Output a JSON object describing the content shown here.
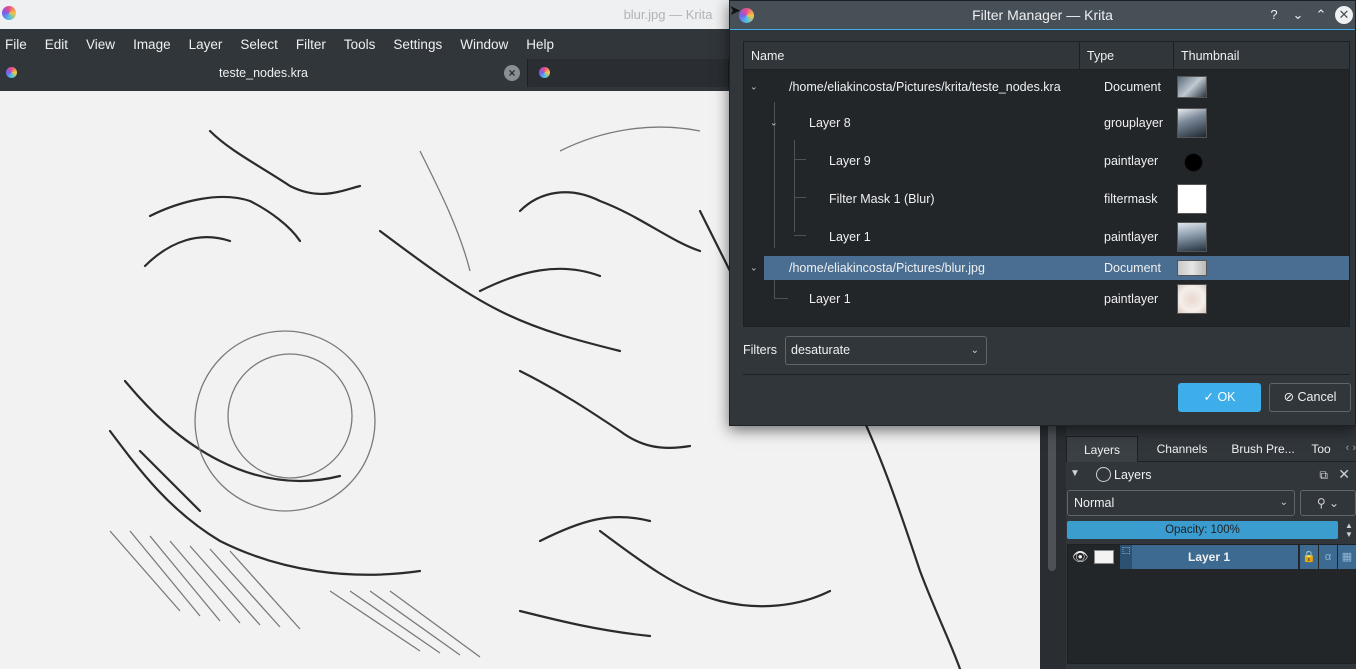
{
  "main_window": {
    "title": "blur.jpg — Krita",
    "menu": [
      "File",
      "Edit",
      "View",
      "Image",
      "Layer",
      "Select",
      "Filter",
      "Tools",
      "Settings",
      "Window",
      "Help"
    ],
    "tabs": [
      {
        "label": "teste_nodes.kra",
        "close_symbol": "×"
      },
      {
        "label": ""
      }
    ]
  },
  "dialog": {
    "title": "Filter Manager — Krita",
    "titlebar_buttons": {
      "help": "?",
      "minimize": "⌄",
      "maximize": "⌃",
      "close": "✕"
    },
    "columns": {
      "name": "Name",
      "type": "Type",
      "thumbnail": "Thumbnail"
    },
    "tree": [
      {
        "name": "/home/eliakincosta/Pictures/krita/teste_nodes.kra",
        "type": "Document",
        "depth": 0,
        "expander": "⌄"
      },
      {
        "name": "Layer 8",
        "type": "grouplayer",
        "depth": 1,
        "expander": "⌄"
      },
      {
        "name": "Layer 9",
        "type": "paintlayer",
        "depth": 2
      },
      {
        "name": "Filter Mask 1 (Blur)",
        "type": "filtermask",
        "depth": 2
      },
      {
        "name": "Layer 1",
        "type": "paintlayer",
        "depth": 2
      },
      {
        "name": "/home/eliakincosta/Pictures/blur.jpg",
        "type": "Document",
        "depth": 0,
        "expander": "⌄",
        "selected": true
      },
      {
        "name": "Layer 1",
        "type": "paintlayer",
        "depth": 1
      }
    ],
    "filters_label": "Filters",
    "filters_value": "desaturate",
    "ok_label": "OK",
    "cancel_label": "Cancel"
  },
  "docker": {
    "tabs": [
      "Layers",
      "Channels",
      "Brush Pre...",
      "Too"
    ],
    "panel_title": "Layers",
    "blend_mode": "Normal",
    "opacity_label": "Opacity:  100%",
    "layers": [
      {
        "name": "Layer 1"
      }
    ]
  },
  "colors": {
    "accent": "#3daee9",
    "selection": "#4a6e92",
    "dark_bg": "#31363b"
  }
}
